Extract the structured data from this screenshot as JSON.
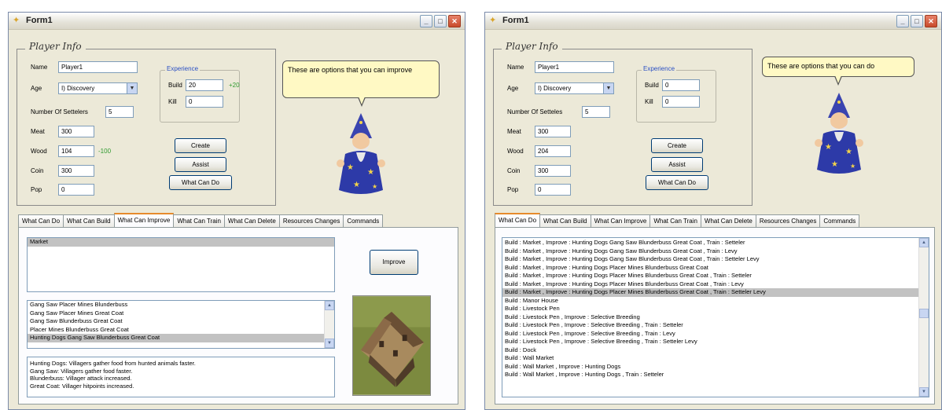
{
  "windows": [
    {
      "title": "Form1",
      "player": {
        "legend": "Player Info",
        "name_label": "Name",
        "name_value": "Player1",
        "age_label": "Age",
        "age_value": "I) Discovery",
        "settlers_label": "Number Of Settelers",
        "settlers_value": "5",
        "meat_label": "Meat",
        "meat_value": "300",
        "wood_label": "Wood",
        "wood_value": "104",
        "wood_delta": "-100",
        "coin_label": "Coin",
        "coin_value": "300",
        "pop_label": "Pop",
        "pop_value": "0"
      },
      "experience": {
        "legend": "Experience",
        "build_label": "Build",
        "build_value": "20",
        "build_delta": "+20",
        "kill_label": "Kill",
        "kill_value": "0"
      },
      "buttons": {
        "create": "Create",
        "assist": "Assist",
        "what_can_do": "What Can Do"
      },
      "bubble_text": "These are options that you can improve",
      "tabs": [
        "What Can Do",
        "What Can Build",
        "What Can Improve",
        "What Can Train",
        "What Can Delete",
        "Resources Changes",
        "Commands"
      ],
      "active_tab": "What Can Improve",
      "improve": {
        "buildings": [
          "Market"
        ],
        "options": [
          "Gang Saw  Placer Mines  Blunderbuss",
          "Gang Saw  Placer Mines  Great Coat",
          "Gang Saw  Blunderbuss  Great Coat",
          "Placer Mines  Blunderbuss  Great Coat",
          "Hunting Dogs  Gang Saw  Blunderbuss  Great Coat"
        ],
        "selected_index": 4,
        "button": "Improve",
        "description": [
          "Hunting Dogs: Villagers gather food from hunted animals faster.",
          "Gang Saw: Villagers gather food faster.",
          "Blunderbuss: Villager attack increased.",
          "Great Coat: Villager hitpoints increased."
        ]
      }
    },
    {
      "title": "Form1",
      "player": {
        "legend": "Player Info",
        "name_label": "Name",
        "name_value": "Player1",
        "age_label": "Age",
        "age_value": "I) Discovery",
        "settlers_label": "Number Of Setteles",
        "settlers_value": "5",
        "meat_label": "Meat",
        "meat_value": "300",
        "wood_label": "Wood",
        "wood_value": "204",
        "coin_label": "Coin",
        "coin_value": "300",
        "pop_label": "Pop",
        "pop_value": "0"
      },
      "experience": {
        "legend": "Experience",
        "build_label": "Build",
        "build_value": "0",
        "kill_label": "Kill",
        "kill_value": "0"
      },
      "buttons": {
        "create": "Create",
        "assist": "Assist",
        "what_can_do": "What Can Do"
      },
      "bubble_text": "These are options that you can do",
      "tabs": [
        "What Can Do",
        "What Can Build",
        "What Can Improve",
        "What Can Train",
        "What Can Delete",
        "Resources Changes",
        "Commands"
      ],
      "active_tab": "What Can Do",
      "do_list": [
        "Build : Market , Improve : Hunting Dogs Gang Saw Blunderbuss Great Coat , Train : Setteler",
        "Build : Market , Improve : Hunting Dogs Gang Saw Blunderbuss Great Coat , Train : Levy",
        "Build : Market , Improve : Hunting Dogs Gang Saw Blunderbuss Great Coat , Train : Setteler Levy",
        "Build : Market , Improve : Hunting Dogs Placer Mines Blunderbuss Great Coat",
        "Build : Market , Improve : Hunting Dogs Placer Mines Blunderbuss Great Coat , Train : Setteler",
        "Build : Market , Improve : Hunting Dogs Placer Mines Blunderbuss Great Coat , Train : Levy",
        "Build : Market , Improve : Hunting Dogs Placer Mines Blunderbuss Great Coat , Train : Setteler Levy",
        "Build : Manor House",
        "Build : Livestock Pen",
        "Build : Livestock Pen , Improve : Selective Breeding",
        "Build : Livestock Pen , Improve : Selective Breeding , Train : Setteler",
        "Build : Livestock Pen , Improve : Selective Breeding , Train : Levy",
        "Build : Livestock Pen , Improve : Selective Breeding , Train : Setteler Levy",
        "Build : Dock",
        "Build : Wall Market",
        "Build : Wall Market , Improve : Hunting Dogs",
        "Build : Wall Market , Improve : Hunting Dogs , Train : Setteler"
      ],
      "selected_index": 6
    }
  ]
}
